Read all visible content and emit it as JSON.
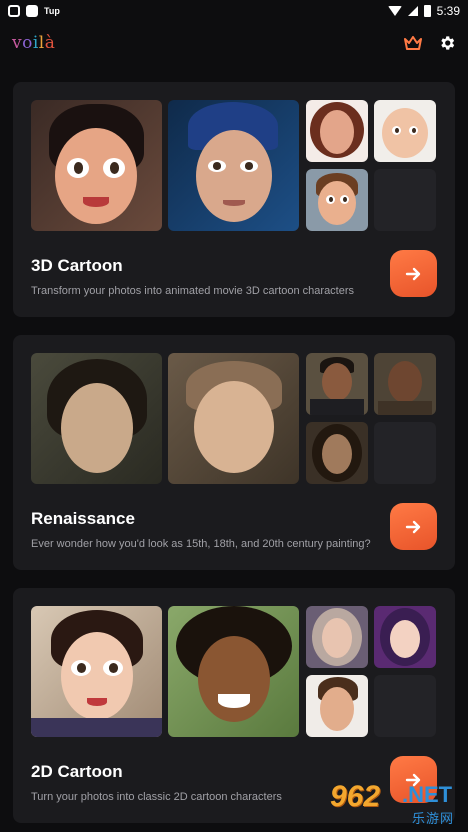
{
  "status_bar": {
    "app_label": "Tup",
    "time": "5:39"
  },
  "header": {
    "logo_letters": [
      "v",
      "o",
      "i",
      "l",
      "à"
    ],
    "premium_icon": "crown-icon",
    "settings_icon": "gear-icon",
    "accent": "#ff7a45"
  },
  "cards": [
    {
      "title": "3D Cartoon",
      "description": "Transform your photos into animated movie 3D cartoon characters",
      "button_icon": "arrow-right-icon"
    },
    {
      "title": "Renaissance",
      "description": "Ever wonder how you'd look as 15th, 18th, and 20th century painting?",
      "button_icon": "arrow-right-icon"
    },
    {
      "title": "2D Cartoon",
      "description": "Turn your photos into classic 2D cartoon characters",
      "button_icon": "arrow-right-icon"
    }
  ],
  "watermark": {
    "number": "962",
    "suffix": ".NET",
    "chinese": "乐游网"
  }
}
